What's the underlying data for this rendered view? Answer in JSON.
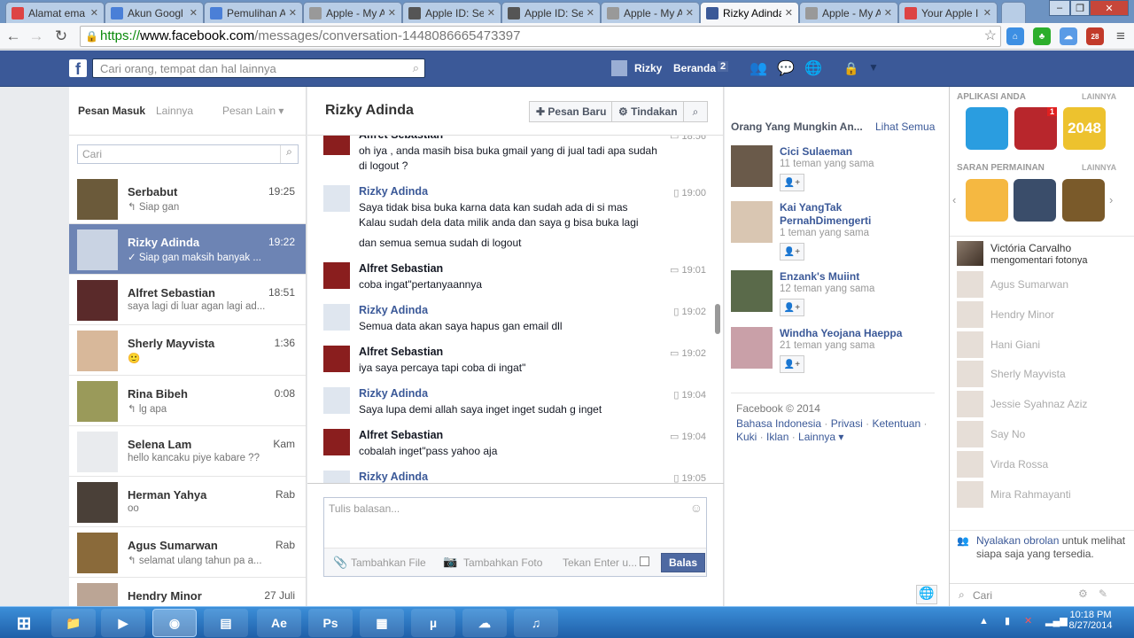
{
  "browser": {
    "tabs": [
      {
        "title": "Alamat ema",
        "icon": "gmail-icon",
        "color": "#d44"
      },
      {
        "title": "Akun Googl",
        "icon": "google-icon",
        "color": "#4a7fd7"
      },
      {
        "title": "Pemulihan A",
        "icon": "google-icon",
        "color": "#4a7fd7"
      },
      {
        "title": "Apple - My A",
        "icon": "page-icon",
        "color": "#999"
      },
      {
        "title": "Apple ID: Se",
        "icon": "apple-icon",
        "color": "#555"
      },
      {
        "title": "Apple ID: Se",
        "icon": "apple-icon",
        "color": "#555"
      },
      {
        "title": "Apple - My A",
        "icon": "page-icon",
        "color": "#999"
      },
      {
        "title": "Rizky Adinda",
        "icon": "facebook-icon",
        "color": "#3b5998"
      },
      {
        "title": "Apple - My A",
        "icon": "page-icon",
        "color": "#999"
      },
      {
        "title": "Your Apple I",
        "icon": "gmail-icon",
        "color": "#d44"
      }
    ],
    "url_scheme": "https://",
    "url_domain": "www.facebook.com",
    "url_path": "/messages/conversation-1448086665473397",
    "abp_count": "28"
  },
  "header": {
    "search_placeholder": "Cari orang, tempat dan hal lainnya",
    "user_name": "Rizky",
    "home_label": "Beranda",
    "home_count": "2"
  },
  "inbox": {
    "tab_inbox": "Pesan Masuk",
    "tab_more": "Lainnya",
    "tab_other": "Pesan Lain",
    "search_placeholder": "Cari",
    "conversations": [
      {
        "name": "Serbabut",
        "time": "19:25",
        "snippet": "↰ Siap gan"
      },
      {
        "name": "Rizky Adinda",
        "time": "19:22",
        "snippet": "✓ Siap gan maksih banyak ..."
      },
      {
        "name": "Alfret Sebastian",
        "time": "18:51",
        "snippet": "saya lagi di luar agan lagi ad..."
      },
      {
        "name": "Sherly Mayvista",
        "time": "1:36",
        "snippet": "🙂"
      },
      {
        "name": "Rina Bibeh",
        "time": "0:08",
        "snippet": "↰ lg apa"
      },
      {
        "name": "Selena Lam",
        "time": "Kam",
        "snippet": "hello kancaku piye kabare ??"
      },
      {
        "name": "Herman Yahya",
        "time": "Rab",
        "snippet": "oo"
      },
      {
        "name": "Agus Sumarwan",
        "time": "Rab",
        "snippet": "↰ selamat ulang tahun pa a..."
      },
      {
        "name": "Hendry Minor",
        "time": "27 Juli",
        "snippet": ""
      }
    ]
  },
  "conversation": {
    "title": "Rizky Adinda",
    "new_message": "Pesan Baru",
    "actions": "Tindakan",
    "messages": [
      {
        "name": "Alfret Sebastian",
        "time": "18:56",
        "lines": [
          "oh iya , anda masih bisa buka gmail yang di jual tadi apa sudah",
          "di logout ?"
        ]
      },
      {
        "name": "Rizky Adinda",
        "time": "19:00",
        "lines": [
          "Saya tidak bisa buka karna data kan sudah ada di si mas",
          "Kalau sudah dela data milik anda dan saya g bisa buka lagi",
          "",
          "dan semua semua sudah di logout"
        ]
      },
      {
        "name": "Alfret Sebastian",
        "time": "19:01",
        "lines": [
          "coba ingat\"pertanyaannya"
        ]
      },
      {
        "name": "Rizky Adinda",
        "time": "19:02",
        "lines": [
          "Semua data akan saya hapus gan email dll"
        ]
      },
      {
        "name": "Alfret Sebastian",
        "time": "19:02",
        "lines": [
          "iya saya percaya tapi coba di ingat\""
        ]
      },
      {
        "name": "Rizky Adinda",
        "time": "19:04",
        "lines": [
          "Saya lupa demi allah saya inget inget sudah g inget"
        ]
      },
      {
        "name": "Alfret Sebastian",
        "time": "19:04",
        "lines": [
          "cobalah inget\"pass yahoo aja"
        ]
      },
      {
        "name": "Rizky Adinda",
        "time": "19:05",
        "lines": []
      }
    ],
    "reply_placeholder": "Tulis balasan...",
    "add_file": "Tambahkan File",
    "add_photo": "Tambahkan Foto",
    "enter_label": "Tekan Enter u...",
    "reply_button": "Balas"
  },
  "suggestions": {
    "heading": "Orang Yang Mungkin An...",
    "see_all": "Lihat Semua",
    "people": [
      {
        "name": "Cici Sulaeman",
        "mutual": "11 teman yang sama"
      },
      {
        "name": "Kai YangTak PernahDimengerti",
        "mutual": "1 teman yang sama"
      },
      {
        "name": "Enzank's Muiint",
        "mutual": "12 teman yang sama"
      },
      {
        "name": "Windha Yeojana Haeppa",
        "mutual": "21 teman yang sama"
      }
    ],
    "copyright": "Facebook © 2014",
    "footer_links": [
      "Bahasa Indonesia",
      "Privasi",
      "Ketentuan",
      "Kuki",
      "Iklan",
      "Lainnya"
    ]
  },
  "sidebar": {
    "apps_heading": "APLIKASI ANDA",
    "apps_more": "LAINNYA",
    "apps": [
      {
        "label": "",
        "color": "#2a9de0"
      },
      {
        "label": "",
        "color": "#b8262c",
        "badge": "1"
      },
      {
        "label": "2048",
        "color": "#edc22e"
      }
    ],
    "games_heading": "SARAN PERMAINAN",
    "games_more": "LAINNYA",
    "ticker_name": "Victória Carvalho",
    "ticker_action": "mengomentari fotonya",
    "chat_users": [
      "Agus Sumarwan",
      "Hendry Minor",
      "Hani Giani",
      "Sherly Mayvista",
      "Jessie Syahnaz Aziz",
      "Say No",
      "Virda Rossa",
      "Mira Rahmayanti"
    ],
    "chat_notice_link": "Nyalakan obrolan",
    "chat_notice_text": "untuk melihat siapa saja yang tersedia.",
    "chat_search": "Cari"
  },
  "taskbar": {
    "time": "10:18 PM",
    "date": "8/27/2014"
  }
}
